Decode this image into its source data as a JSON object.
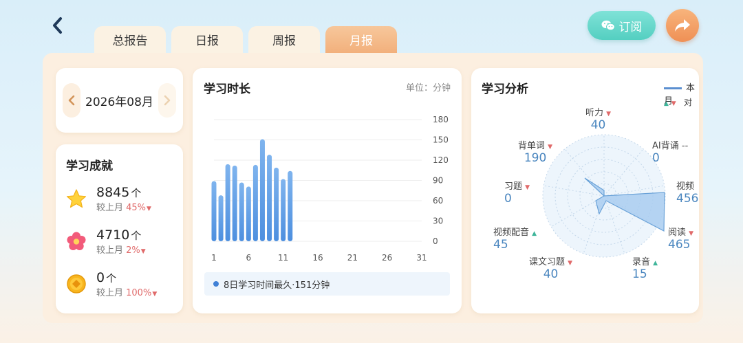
{
  "nav": {
    "back_icon": "chevron-left-icon"
  },
  "tabs": [
    {
      "label": "总报告",
      "active": false
    },
    {
      "label": "日报",
      "active": false
    },
    {
      "label": "周报",
      "active": false
    },
    {
      "label": "月报",
      "active": true
    }
  ],
  "header": {
    "subscribe_label": "订阅",
    "subscribe_icon": "wechat-icon",
    "share_icon": "share-arrow-icon"
  },
  "date_picker": {
    "label": "2026年08月"
  },
  "achievements": {
    "title": "学习成就",
    "items": [
      {
        "icon": "star-icon",
        "value": "8845",
        "unit": "个",
        "compare_prefix": "较上月 ",
        "pct": "45%"
      },
      {
        "icon": "flower-icon",
        "value": "4710",
        "unit": "个",
        "compare_prefix": "较上月 ",
        "pct": "2%"
      },
      {
        "icon": "coin-icon",
        "value": "0",
        "unit": "个",
        "compare_prefix": "较上月 ",
        "pct": "100%"
      }
    ]
  },
  "study_time": {
    "title": "学习时长",
    "unit_label": "单位：分钟",
    "legend": "8日学习时间最久·151分钟"
  },
  "chart_data": {
    "type": "bar",
    "title": "学习时长",
    "ylabel": "单位：分钟",
    "x": [
      1,
      2,
      3,
      4,
      5,
      6,
      7,
      8,
      9,
      10,
      11,
      12
    ],
    "values": [
      89,
      68,
      114,
      112,
      87,
      81,
      113,
      151,
      128,
      109,
      92,
      104
    ],
    "x_ticks": [
      "1",
      "6",
      "11",
      "16",
      "21",
      "26",
      "31"
    ],
    "y_ticks": [
      "0",
      "30",
      "60",
      "90",
      "120",
      "150",
      "180"
    ],
    "xlim": [
      1,
      31
    ],
    "ylim": [
      0,
      180
    ],
    "grid": true,
    "bar_color": "#4d8fdf"
  },
  "analysis": {
    "title": "学习分析",
    "legend_current": "本月",
    "legend_compare": "对",
    "axes": [
      {
        "name": "听力",
        "value": "40",
        "trend": "down"
      },
      {
        "name": "AI背诵",
        "value": "0",
        "trend": "none",
        "trend_text": "--"
      },
      {
        "name": "视频",
        "value": "456",
        "trend": "none"
      },
      {
        "name": "阅读",
        "value": "465",
        "trend": "down"
      },
      {
        "name": "录音",
        "value": "15",
        "trend": "up"
      },
      {
        "name": "课文习题",
        "value": "40",
        "trend": "down"
      },
      {
        "name": "视频配音",
        "value": "45",
        "trend": "up"
      },
      {
        "name": "习题",
        "value": "0",
        "trend": "down"
      },
      {
        "name": "背单词",
        "value": "190",
        "trend": "down"
      }
    ]
  }
}
